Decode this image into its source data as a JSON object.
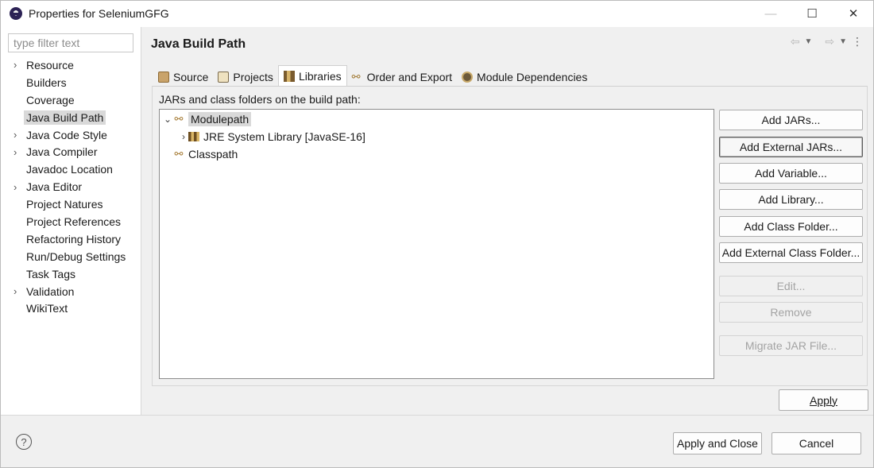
{
  "window": {
    "title": "Properties for SeleniumGFG",
    "controls": {
      "minimize": "—",
      "maximize": "☐",
      "close": "✕"
    }
  },
  "sidebar": {
    "filter_placeholder": "type filter text",
    "items": [
      {
        "label": "Resource",
        "expandable": true
      },
      {
        "label": "Builders",
        "expandable": false
      },
      {
        "label": "Coverage",
        "expandable": false
      },
      {
        "label": "Java Build Path",
        "expandable": false,
        "selected": true
      },
      {
        "label": "Java Code Style",
        "expandable": true
      },
      {
        "label": "Java Compiler",
        "expandable": true
      },
      {
        "label": "Javadoc Location",
        "expandable": false
      },
      {
        "label": "Java Editor",
        "expandable": true
      },
      {
        "label": "Project Natures",
        "expandable": false
      },
      {
        "label": "Project References",
        "expandable": false
      },
      {
        "label": "Refactoring History",
        "expandable": false
      },
      {
        "label": "Run/Debug Settings",
        "expandable": false
      },
      {
        "label": "Task Tags",
        "expandable": false
      },
      {
        "label": "Validation",
        "expandable": true
      },
      {
        "label": "WikiText",
        "expandable": false
      }
    ]
  },
  "main": {
    "title": "Java Build Path",
    "tabs": [
      {
        "label": "Source",
        "icon": "source-folder-icon"
      },
      {
        "label": "Projects",
        "icon": "projects-icon"
      },
      {
        "label": "Libraries",
        "icon": "library-icon",
        "active": true
      },
      {
        "label": "Order and Export",
        "icon": "order-export-icon"
      },
      {
        "label": "Module Dependencies",
        "icon": "module-icon"
      }
    ],
    "description": "JARs and class folders on the build path:",
    "tree": {
      "modulepath": "Modulepath",
      "jre": "JRE System Library [JavaSE-16]",
      "classpath": "Classpath"
    },
    "buttons": {
      "add_jars": "Add JARs...",
      "add_external_jars": "Add External JARs...",
      "add_variable": "Add Variable...",
      "add_library": "Add Library...",
      "add_class_folder": "Add Class Folder...",
      "add_external_class_folder": "Add External Class Folder...",
      "edit": "Edit...",
      "remove": "Remove",
      "migrate_jar": "Migrate JAR File..."
    },
    "apply": "Apply"
  },
  "footer": {
    "help": "?",
    "apply_and_close": "Apply and Close",
    "cancel": "Cancel"
  }
}
